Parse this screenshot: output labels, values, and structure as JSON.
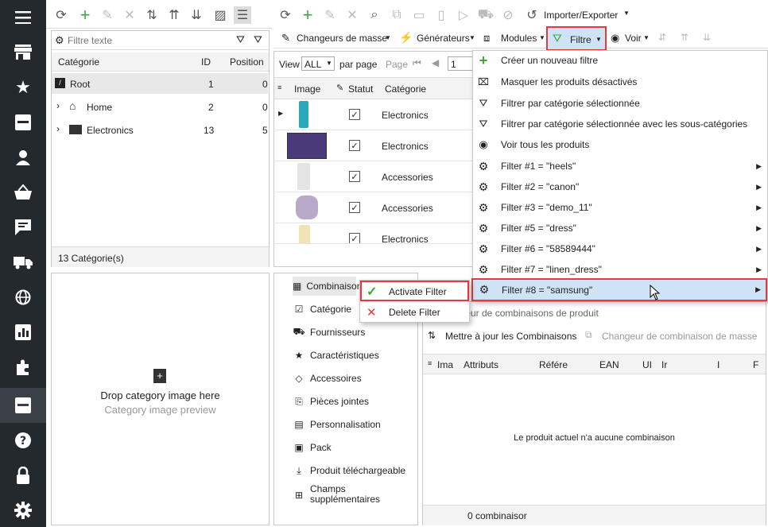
{
  "main_toolbar": {
    "importer_exporter": "Importer/Exporter",
    "changeurs_de_masse": "Changeurs de masse",
    "generateurs": "Générateurs",
    "modules": "Modules",
    "filtre": "Filtre",
    "voir": "Voir"
  },
  "category_panel": {
    "filter_placeholder": "Filtre texte",
    "columns": [
      "Catégorie",
      "ID",
      "Position"
    ],
    "rows": [
      {
        "name": "Root",
        "id": "1",
        "position": "0"
      },
      {
        "name": "Home",
        "id": "2",
        "position": "0"
      },
      {
        "name": "Electronics",
        "id": "13",
        "position": "5"
      }
    ],
    "footer": "13 Catégorie(s)"
  },
  "image_panel": {
    "drop_text": "Drop category image here",
    "preview_text": "Category image preview"
  },
  "products_panel": {
    "view_label": "View",
    "view_value": "ALL",
    "per_page": "par page",
    "page_label": "Page",
    "page_value": "1",
    "columns": [
      "Image",
      "Statut",
      "Catégorie"
    ],
    "rows": [
      {
        "category": "Electronics"
      },
      {
        "category": "Electronics"
      },
      {
        "category": "Accessories"
      },
      {
        "category": "Accessories"
      },
      {
        "category": "Electronics"
      }
    ]
  },
  "detail_tabs": [
    "Combinaisons",
    "Catégorie",
    "Fournisseurs",
    "Caractéristiques",
    "Accessoires",
    "Pièces jointes",
    "Personnalisation",
    "Pack",
    "Produit téléchargeable",
    "Champs supplémentaires"
  ],
  "combinations_panel": {
    "generator_partial": "teur de combinaisons de produit",
    "update_button": "Mettre à jour les Combinaisons",
    "mass_changer": "Changeur de combinaison de masse",
    "columns": [
      "Ima",
      "Attributs",
      "Référe",
      "EAN",
      "UI",
      "Ir",
      "I",
      "F"
    ],
    "empty_message": "Le produit actuel n'a aucune combinaison",
    "footer": "0 combinaisor"
  },
  "filter_menu": {
    "items": [
      {
        "label": "Créer un nouveau filtre",
        "icon": "plus-icon",
        "submenu": false
      },
      {
        "label": "Masquer les produits désactivés",
        "icon": "hide-icon",
        "submenu": false
      },
      {
        "label": "Filtrer par catégorie sélectionnée",
        "icon": "folder-filter-icon",
        "submenu": false
      },
      {
        "label": "Filtrer par catégorie sélectionnée avec les sous-catégories",
        "icon": "folder-tree-icon",
        "submenu": false
      },
      {
        "label": "Voir tous les produits",
        "icon": "eye-icon",
        "submenu": false
      },
      {
        "label": "Filter #1 = \"heels\"",
        "icon": "filter-gear-icon",
        "submenu": true
      },
      {
        "label": "Filter #2 = \"canon\"",
        "icon": "filter-gear-icon",
        "submenu": true
      },
      {
        "label": "Filter #3 = \"demo_11\"",
        "icon": "filter-gear-icon",
        "submenu": true
      },
      {
        "label": "Filter #5 = \"dress\"",
        "icon": "filter-gear-icon",
        "submenu": true
      },
      {
        "label": "Filter #6 = \"58589444\"",
        "icon": "filter-gear-icon",
        "submenu": true
      },
      {
        "label": "Filter #7 = \"linen_dress\"",
        "icon": "filter-gear-icon",
        "submenu": true
      },
      {
        "label": "Filter #8 = \"samsung\"",
        "icon": "filter-gear-icon",
        "submenu": true
      }
    ]
  },
  "submenu": {
    "activate": "Activate Filter",
    "delete": "Delete Filter"
  },
  "colors": {
    "sidebar": "#24292d",
    "highlight_red": "#e23b3b",
    "check_green": "#3aa935",
    "menu_hover": "#cfe3f7"
  }
}
